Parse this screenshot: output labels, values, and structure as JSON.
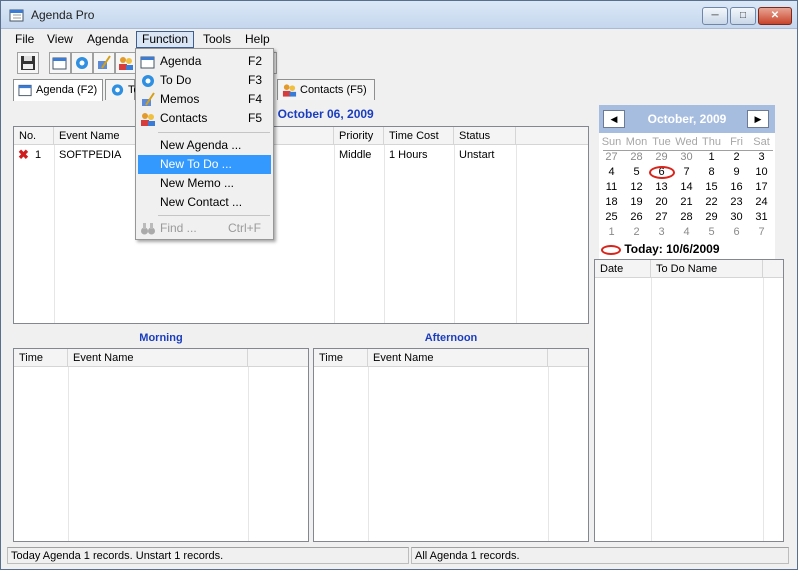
{
  "window": {
    "title": "Agenda Pro",
    "min": "─",
    "max": "□",
    "close": "✕"
  },
  "menubar": [
    "File",
    "View",
    "Agenda",
    "Function",
    "Tools",
    "Help"
  ],
  "tabs": [
    {
      "label": "Agenda (F2)",
      "icon": "agenda-icon"
    },
    {
      "label": "To",
      "icon": "todo-icon"
    },
    {
      "label": "Contacts (F5)",
      "icon": "contacts-icon"
    }
  ],
  "date_header": ", October 06, 2009",
  "agenda_table": {
    "headers": [
      "No.",
      "Event Name",
      "Priority",
      "Time Cost",
      "Status"
    ],
    "rows": [
      {
        "no": "1",
        "event": "SOFTPEDIA",
        "priority": "Middle",
        "time_cost": "1 Hours",
        "status": "Unstart",
        "icon": "delete-x-icon"
      }
    ]
  },
  "morning": {
    "title": "Morning",
    "headers": [
      "Time",
      "Event Name"
    ]
  },
  "afternoon": {
    "title": "Afternoon",
    "headers": [
      "Time",
      "Event Name"
    ]
  },
  "calendar": {
    "month": "October, 2009",
    "prev": "◀",
    "next": "▶",
    "dow": [
      "Sun",
      "Mon",
      "Tue",
      "Wed",
      "Thu",
      "Fri",
      "Sat"
    ],
    "weeks": [
      [
        "27",
        "28",
        "29",
        "30",
        "1",
        "2",
        "3"
      ],
      [
        "4",
        "5",
        "6",
        "7",
        "8",
        "9",
        "10"
      ],
      [
        "11",
        "12",
        "13",
        "14",
        "15",
        "16",
        "17"
      ],
      [
        "18",
        "19",
        "20",
        "21",
        "22",
        "23",
        "24"
      ],
      [
        "25",
        "26",
        "27",
        "28",
        "29",
        "30",
        "31"
      ],
      [
        "1",
        "2",
        "3",
        "4",
        "5",
        "6",
        "7"
      ]
    ],
    "today_label": "Today: 10/6/2009"
  },
  "todo_table": {
    "headers": [
      "Date",
      "To Do Name"
    ]
  },
  "function_menu": {
    "items": [
      {
        "label": "Agenda",
        "key": "F2",
        "icon": "agenda-icon"
      },
      {
        "label": "To Do",
        "key": "F3",
        "icon": "todo-icon"
      },
      {
        "label": "Memos",
        "key": "F4",
        "icon": "memos-icon"
      },
      {
        "label": "Contacts",
        "key": "F5",
        "icon": "contacts-icon"
      }
    ],
    "new_items": [
      "New Agenda ...",
      "New To Do ...",
      "New Memo ...",
      "New Contact ..."
    ],
    "find": {
      "label": "Find ...",
      "key": "Ctrl+F",
      "icon": "binoculars-icon"
    }
  },
  "status": {
    "left": "Today Agenda 1 records. Unstart 1 records.",
    "right": "All Agenda 1 records."
  },
  "colors": {
    "accent_blue": "#1a3dbf",
    "calendar_header": "#a7bde0",
    "highlight": "#3399ff",
    "today_ring": "#d8241a"
  }
}
